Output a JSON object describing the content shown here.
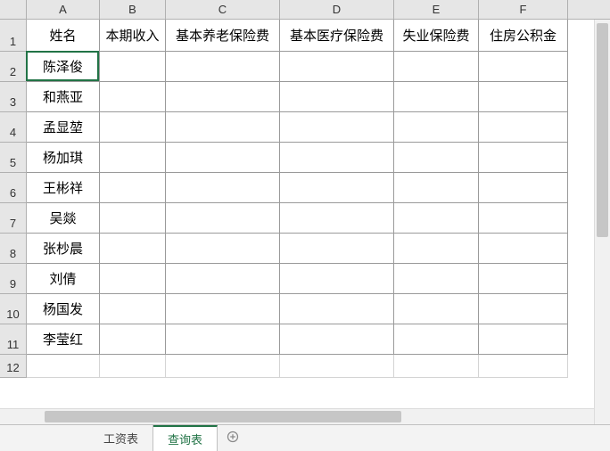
{
  "columns": [
    "A",
    "B",
    "C",
    "D",
    "E",
    "F"
  ],
  "rows": [
    "1",
    "2",
    "3",
    "4",
    "5",
    "6",
    "7",
    "8",
    "9",
    "10",
    "11",
    "12"
  ],
  "headers": {
    "A": "姓名",
    "B": "本期收入",
    "C": "基本养老保险费",
    "D": "基本医疗保险费",
    "E": "失业保险费",
    "F": "住房公积金"
  },
  "names": [
    "陈泽俊",
    "和燕亚",
    "孟显堃",
    "杨加琪",
    "王彬祥",
    "吴燚",
    "张杪晨",
    "刘倩",
    "杨国发",
    "李莹红"
  ],
  "chart_data": {
    "type": "table",
    "columns": [
      "姓名",
      "本期收入",
      "基本养老保险费",
      "基本医疗保险费",
      "失业保险费",
      "住房公积金"
    ],
    "rows": [
      [
        "陈泽俊",
        "",
        "",
        "",
        "",
        ""
      ],
      [
        "和燕亚",
        "",
        "",
        "",
        "",
        ""
      ],
      [
        "孟显堃",
        "",
        "",
        "",
        "",
        ""
      ],
      [
        "杨加琪",
        "",
        "",
        "",
        "",
        ""
      ],
      [
        "王彬祥",
        "",
        "",
        "",
        "",
        ""
      ],
      [
        "吴燚",
        "",
        "",
        "",
        "",
        ""
      ],
      [
        "张杪晨",
        "",
        "",
        "",
        "",
        ""
      ],
      [
        "刘倩",
        "",
        "",
        "",
        "",
        ""
      ],
      [
        "杨国发",
        "",
        "",
        "",
        "",
        ""
      ],
      [
        "李莹红",
        "",
        "",
        "",
        "",
        ""
      ]
    ]
  },
  "tabs": {
    "t1": "工资表",
    "t2": "查询表"
  },
  "active_cell": "A2"
}
